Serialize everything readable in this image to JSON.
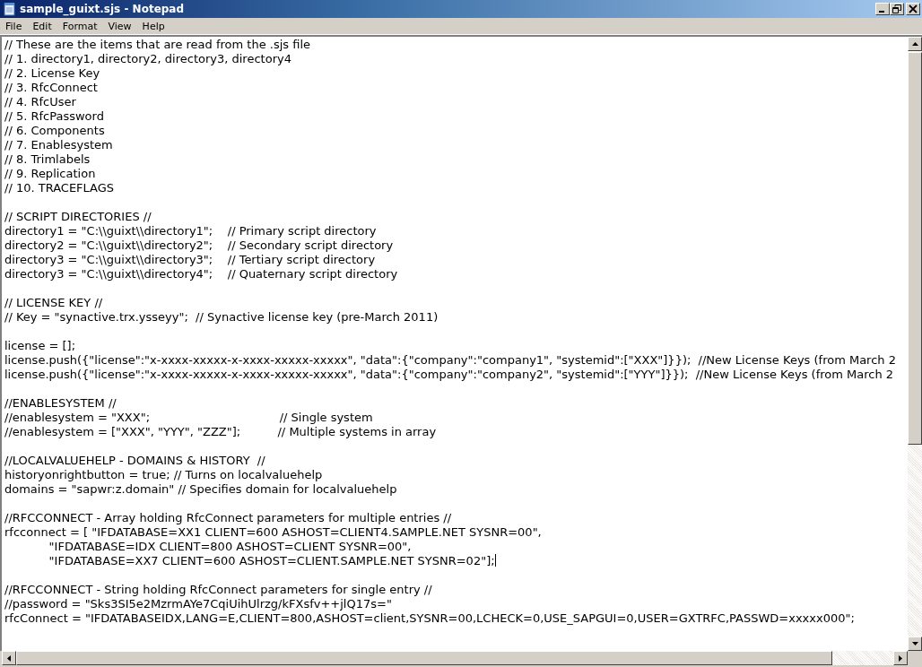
{
  "window": {
    "title": "sample_guixt.sjs - Notepad"
  },
  "menu": [
    "File",
    "Edit",
    "Format",
    "View",
    "Help"
  ],
  "document": {
    "blocks": [
      [
        "// These are the items that are read from the .sjs file",
        "// 1. directory1, directory2, directory3, directory4",
        "// 2. License Key",
        "// 3. RfcConnect",
        "// 4. RfcUser",
        "// 5. RfcPassword",
        "// 6. Components",
        "// 7. Enablesystem",
        "// 8. Trimlabels",
        "// 9. Replication",
        "// 10. TRACEFLAGS"
      ],
      [
        "// SCRIPT DIRECTORIES //",
        "directory1 = \"C:\\\\guixt\\\\directory1\";    // Primary script directory",
        "directory2 = \"C:\\\\guixt\\\\directory2\";    // Secondary script directory",
        "directory3 = \"C:\\\\guixt\\\\directory3\";    // Tertiary script directory",
        "directory3 = \"C:\\\\guixt\\\\directory4\";    // Quaternary script directory"
      ],
      [
        "// LICENSE KEY //",
        "// Key = \"synactive.trx.ysseyy\";  // Synactive license key (pre-March 2011)"
      ],
      [
        "license = [];",
        "license.push({\"license\":\"x-xxxx-xxxxx-x-xxxx-xxxxx-xxxxx\", \"data\":{\"company\":\"company1\", \"systemid\":[\"XXX\"]}});  //New License Keys (from March 2",
        "license.push({\"license\":\"x-xxxx-xxxxx-x-xxxx-xxxxx-xxxxx\", \"data\":{\"company\":\"company2\", \"systemid\":[\"YYY\"]}});  //New License Keys (from March 2"
      ],
      [
        "//ENABLESYSTEM //",
        "//enablesystem = \"XXX\";                                   // Single system",
        "//enablesystem = [\"XXX\", \"YYY\", \"ZZZ\"];          // Multiple systems in array"
      ],
      [
        "//LOCALVALUEHELP - DOMAINS & HISTORY  //",
        "historyonrightbutton = true; // Turns on localvaluehelp",
        "domains = \"sapwr:z.domain\" // Specifies domain for localvaluehelp"
      ],
      [
        "//RFCCONNECT - Array holding RfcConnect parameters for multiple entries //",
        "rfcconnect = [ \"IFDATABASE=XX1 CLIENT=600 ASHOST=CLIENT4.SAMPLE.NET SYSNR=00\",",
        "            \"IFDATABASE=IDX CLIENT=800 ASHOST=CLIENT SYSNR=00\",",
        "            \"IFDATABASE=XX7 CLIENT=600 ASHOST=CLIENT.SAMPLE.NET SYSNR=02\"];"
      ],
      [
        "//RFCCONNECT - String holding RfcConnect parameters for single entry //",
        "//password = \"Sks3SI5e2MzrmAYe7CqiUihUlrzg/kFXsfv++jlQ17s=\"",
        "rfcConnect = \"IFDATABASEIDX,LANG=E,CLIENT=800,ASHOST=client,SYSNR=00,LCHECK=0,USE_SAPGUI=0,USER=GXTRFC,PASSWD=xxxxx000\";"
      ]
    ]
  }
}
